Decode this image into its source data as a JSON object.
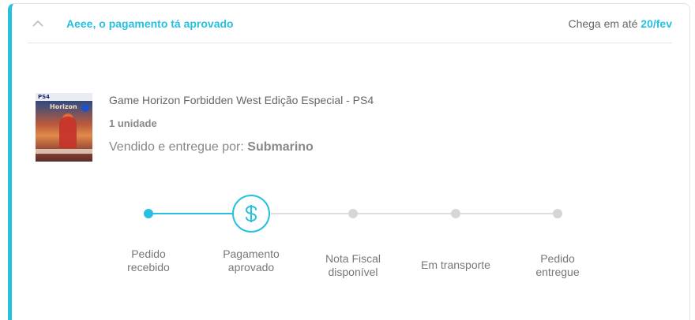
{
  "order": {
    "status_title": "Aeee, o pagamento tá aprovado",
    "delivery_prefix": "Chega em até",
    "delivery_date": "20/fev"
  },
  "product": {
    "name": "Game Horizon Forbidden West Edição Especial - PS4",
    "quantity": "1 unidade",
    "seller_prefix": "Vendido e entregue por:",
    "seller_name": "Submarino",
    "thumb_badge": "PS4",
    "thumb_logo": "Horizon"
  },
  "tracker": {
    "steps": [
      {
        "line1": "Pedido",
        "line2": "recebido",
        "state": "done"
      },
      {
        "line1": "Pagamento",
        "line2": "aprovado",
        "state": "current"
      },
      {
        "line1": "Nota Fiscal",
        "line2": "disponível",
        "state": "pending"
      },
      {
        "line1": "Em transporte",
        "line2": "",
        "state": "pending"
      },
      {
        "line1": "Pedido",
        "line2": "entregue",
        "state": "pending"
      }
    ]
  },
  "colors": {
    "accent": "#27c0df",
    "pending": "#d6d6d6"
  },
  "icons": {
    "collapse": "chevron-up-icon",
    "current_step": "dollar-icon"
  }
}
